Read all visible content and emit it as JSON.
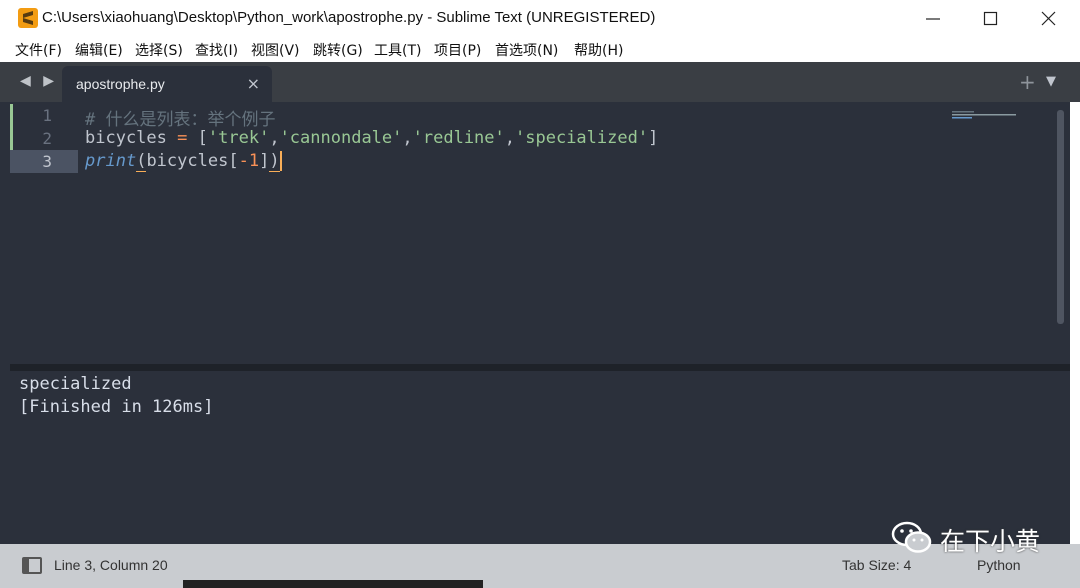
{
  "window": {
    "title": "C:\\Users\\xiaohuang\\Desktop\\Python_work\\apostrophe.py - Sublime Text (UNREGISTERED)",
    "app_icon": "sublime-icon",
    "controls": [
      "minimize-icon",
      "maximize-icon",
      "close-icon"
    ]
  },
  "menu": {
    "items": [
      "文件(F)",
      "编辑(E)",
      "选择(S)",
      "查找(I)",
      "视图(V)",
      "跳转(G)",
      "工具(T)",
      "项目(P)",
      "首选项(N)",
      "帮助(H)"
    ]
  },
  "tabs": {
    "active": "apostrophe.py",
    "nav": "◀ ▶",
    "close": "×",
    "plus": "+",
    "dropdown": "▼"
  },
  "editor": {
    "line_numbers": [
      "1",
      "2",
      "3"
    ],
    "line1_comment": "# 什么是列表：举个例子",
    "line2": {
      "var": "bicycles",
      "eq": "=",
      "open": "[",
      "s1": "'trek'",
      "s2": "'cannondale'",
      "s3": "'redline'",
      "s4": "'specialized'",
      "comma": ",",
      "close": "]"
    },
    "line3": {
      "fn": "print",
      "lparen": "(",
      "arg": "bicycles",
      "lbr": "[",
      "neg": "-",
      "idx": "1",
      "rbr": "]",
      "rparen": ")"
    }
  },
  "output": {
    "lines": [
      "specialized",
      "[Finished in 126ms]"
    ]
  },
  "status": {
    "position": "Line 3, Column 20",
    "tab_size": "Tab Size: 4",
    "syntax": "Python"
  },
  "watermark": {
    "text": "在下小黄",
    "icon": "wechat-icon"
  },
  "colors": {
    "background": "#2b303b",
    "comment": "#65737e",
    "string": "#99c794",
    "operator": "#f99157",
    "builtin": "#6699cc"
  }
}
